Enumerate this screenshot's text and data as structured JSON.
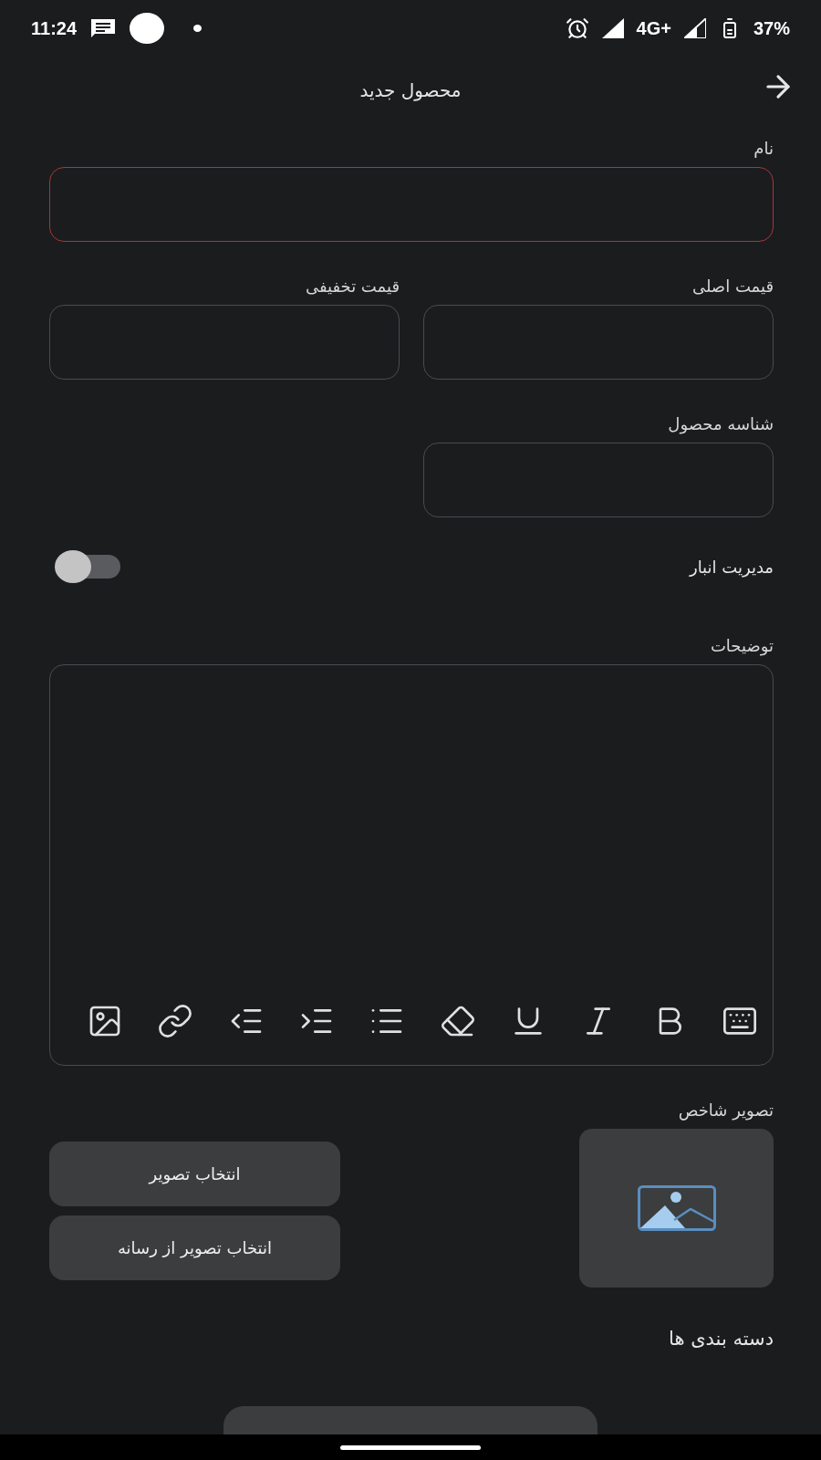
{
  "status_bar": {
    "time": "11:24",
    "network": "4G+",
    "battery": "37%"
  },
  "header": {
    "title": "محصول جدید"
  },
  "name_field": {
    "label": "نام",
    "error": true
  },
  "price_fields": [
    {
      "label": "قیمت اصلی",
      "error": false
    },
    {
      "label": "قیمت تخفیفی",
      "error": false
    }
  ],
  "product_id_field": {
    "label": "شناسه محصول",
    "error": false
  },
  "inventory": {
    "label": "مدیریت انبار",
    "on": false
  },
  "description": {
    "label": "توضیحات"
  },
  "featured_image": {
    "label": "تصویر شاخص",
    "buttons": [
      "انتخاب تصویر",
      "انتخاب تصویر از رسانه"
    ]
  },
  "categories": {
    "title": "دسته بندی ها"
  }
}
